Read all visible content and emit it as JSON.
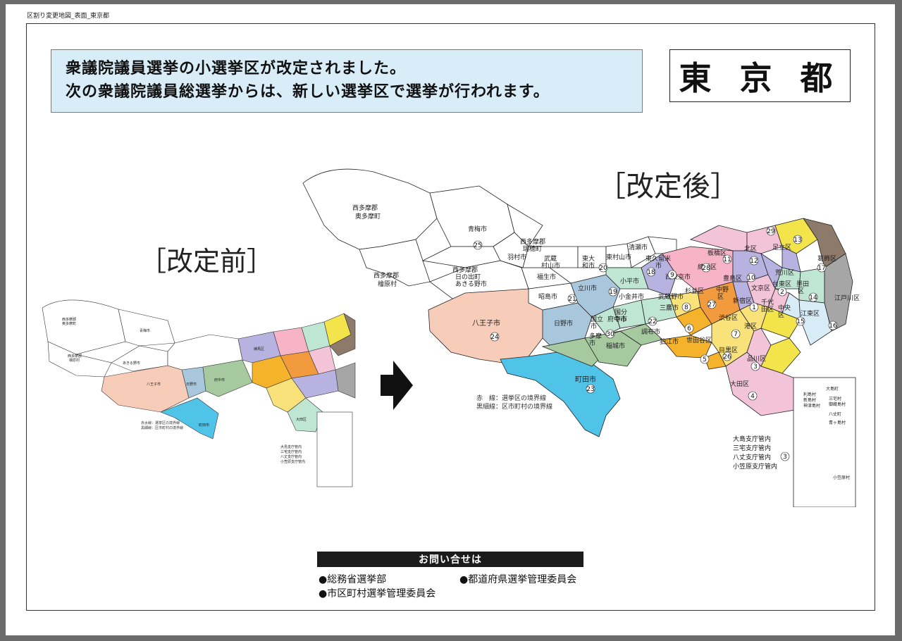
{
  "file_label": "区割り変更地図_表面_東京都",
  "notice": {
    "line1": "衆議院議員選挙の小選挙区が改定されました。",
    "line2": "次の衆議院議員総選挙からは、新しい選挙区で選挙が行われます。"
  },
  "prefecture": "東 京 都",
  "before_title": "［改定前］",
  "after_title": "［改定後］",
  "after_map": {
    "labels": {
      "okutama": "西多摩郡\n奥多摩町",
      "hinohara": "西多摩郡\n檜原村",
      "ome": "青梅市",
      "mizuho": "西多摩郡\n瑞穂町",
      "hinode": "西多摩郡\n日の出町",
      "hamura": "羽村市",
      "akiruno": "あきる野市",
      "musashimurayama": "武蔵\n村山市",
      "higashiyamato": "東大\n和市",
      "higashimurayama": "東村山市",
      "kiyose": "清瀬市",
      "higashikurume": "東久留米\n市",
      "fussa": "福生市",
      "akishima": "昭島市",
      "tachikawa": "立川市",
      "kodaira": "小平市",
      "nishitokyo": "西東京市",
      "hachioji": "八王子市",
      "hino": "日野市",
      "kunitachi": "国立\n市",
      "kokubunji": "国分\n寺市",
      "koganei": "小金井市",
      "musashino": "武蔵野市",
      "fuchu": "府中市",
      "mitaka": "三鷹市",
      "chofu": "調布市",
      "komae": "狛江市",
      "tama": "多摩\n市",
      "inagi": "稲城市",
      "machida": "町田市",
      "nerima": "練馬区",
      "itabashi": "板橋区",
      "kita": "北区",
      "adachi": "足立区",
      "katsushika": "葛飾区",
      "arakawa": "荒川区",
      "suginami": "杉並区",
      "nakano": "中野\n区",
      "toshima": "豊島区",
      "bunkyo": "文京区",
      "taito": "台東区",
      "sumida": "墨田\n区",
      "edogawa": "江戸川区",
      "shinjuku": "新宿区",
      "chiyoda": "千代\n田区",
      "chuo": "中央\n区",
      "koto": "江東区",
      "shibuya": "渋谷区",
      "minato": "港区",
      "setagaya": "世田谷区",
      "meguro": "目黒区",
      "shinagawa": "品川区",
      "ota": "大田区"
    },
    "district_numbers": [
      "1",
      "2",
      "3",
      "4",
      "5",
      "6",
      "7",
      "8",
      "9",
      "10",
      "11",
      "12",
      "13",
      "14",
      "15",
      "16",
      "17",
      "18",
      "19",
      "20",
      "21",
      "22",
      "23",
      "24",
      "25",
      "26",
      "27",
      "28",
      "29",
      "30"
    ],
    "islands": [
      "大島町",
      "利島村",
      "新島村",
      "神津島村",
      "三宅村",
      "御蔵島村",
      "八丈町",
      "青ヶ島村",
      "小笠原村"
    ],
    "legend": [
      "赤　線：選挙区の境界線",
      "黒細線：区市町村の境界線"
    ],
    "branch_offices": [
      "大島支庁管内",
      "三宅支庁管内",
      "八丈支庁管内",
      "小笠原支庁管内"
    ],
    "branch_number": "3"
  },
  "before_map": {
    "labels": {
      "okutama": "西多摩郡\n奥多摩町",
      "hinohara": "西多摩郡\n檜原村",
      "ome": "青梅市",
      "akiruno": "あきる野市",
      "hachioji": "八王子市",
      "hino": "日野市",
      "fuchu": "府中市",
      "machida": "町田市",
      "nerima": "練馬区",
      "ota": "大田区"
    },
    "legend": [
      "赤太線：選挙区の境界線",
      "黒細線：区市町村の境界線"
    ],
    "branch_offices": [
      "大島支庁管内",
      "三宅支庁管内",
      "八丈支庁管内",
      "小笠原支庁管内"
    ]
  },
  "contact": {
    "header": "お問い合せは",
    "items": [
      "●総務省選挙部",
      "●都道府県選挙管理委員会",
      "●市区町村選挙管理委員会"
    ]
  },
  "colors": {
    "hachioji": "#f7cdb9",
    "machida": "#4fc3e8",
    "hino": "#a9c7dc",
    "fuchu": "#a6c9a0",
    "suginami": "#f19a3e",
    "chofu": "#f5b22b",
    "setagaya": "#f9e27a",
    "nerima": "#f7b4c8",
    "adachi": "#f2e44a",
    "katsushika": "#8d7a6a",
    "edogawa": "#a6a6a6",
    "lavender": "#b8b2e0",
    "pink": "#f3c3d8",
    "mint": "#bfe5d3"
  }
}
